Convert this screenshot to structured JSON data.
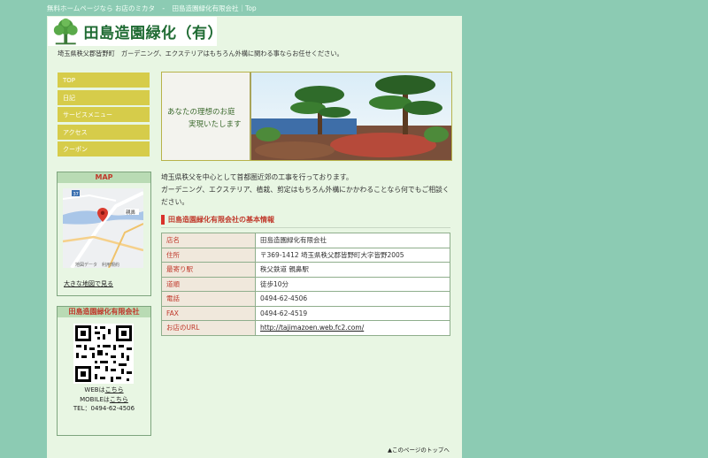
{
  "topbar": {
    "left": "無料ホームページなら お店のミカタ",
    "sep": "-",
    "right": "田島造園緑化有限会社｜Top"
  },
  "logo": {
    "text": "田島造園緑化（有）"
  },
  "tagline": "埼玉県秩父郡皆野町　ガーデニング、エクステリアはもちろん外構に関わる事ならお任せください。",
  "nav": {
    "items": [
      "TOP",
      "日記",
      "サービスメニュー",
      "アクセス",
      "クーポン"
    ]
  },
  "map": {
    "heading": "MAP",
    "link": "大きな地図で見る",
    "badge": "37",
    "place": "親鼻",
    "copyright": "地図データ　利用規約"
  },
  "qr": {
    "heading": "田島造園緑化有限会社",
    "web_prefix": "WEBは",
    "web_link": "こちら",
    "mobile_prefix": "MOBILEは",
    "mobile_link": "こちら",
    "tel": "TEL：0494-62-4506"
  },
  "banner": {
    "line1": "あなたの理想のお庭",
    "line2": "実現いたします"
  },
  "intro": {
    "p1": "埼玉県秩父を中心として首都圏近郊の工事を行っております。",
    "p2": "ガーデニング、エクステリア、植栽、剪定はもちろん外構にかかわることなら何でもご相談ください。"
  },
  "section_title": "田島造園緑化有限会社の基本情報",
  "info": {
    "rows": [
      {
        "key": "店名",
        "value": "田島造園緑化有限会社"
      },
      {
        "key": "住所",
        "value": "〒369-1412 埼玉県秩父郡皆野町大字皆野2005"
      },
      {
        "key": "最寄り駅",
        "value": "秩父鉄道 親鼻駅"
      },
      {
        "key": "道順",
        "value": "徒歩10分"
      },
      {
        "key": "電話",
        "value": "0494-62-4506"
      },
      {
        "key": "FAX",
        "value": "0494-62-4519"
      },
      {
        "key": "お店のURL",
        "value": "http://tajimazoen.web.fc2.com/"
      }
    ]
  },
  "pagetop": "▲このページのトップへ",
  "colors": {
    "background": "#8ccbb3",
    "page": "#e8f6e3",
    "nav": "#d6cc4a",
    "accent": "#c0392b"
  }
}
